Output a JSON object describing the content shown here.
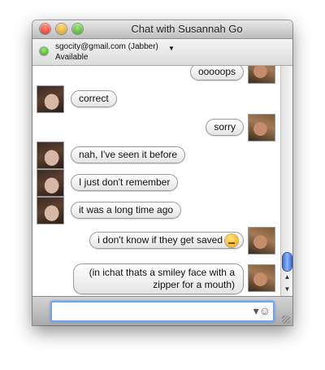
{
  "window": {
    "title": "Chat with Susannah Go"
  },
  "account": {
    "name": "sgocity@gmail.com (Jabber)",
    "presence": "Available"
  },
  "messages": [
    {
      "from": "him",
      "text": "ooooops"
    },
    {
      "from": "her",
      "text": "correct"
    },
    {
      "from": "him",
      "text": "sorry"
    },
    {
      "from": "her",
      "text": "nah, I've seen it before"
    },
    {
      "from": "her",
      "text": "I just don't remember"
    },
    {
      "from": "her",
      "text": "it was a long time ago"
    },
    {
      "from": "him",
      "text": "i don't know if they get saved"
    },
    {
      "from": "him",
      "text": "(in ichat thats a smiley face with a zipper for a mouth)"
    }
  ],
  "input": {
    "value": "",
    "placeholder": ""
  },
  "icons": {
    "close": "close-icon",
    "minimize": "minimize-icon",
    "zoom": "zoom-icon",
    "status": "status-available-icon",
    "account_menu": "chevron-down-icon",
    "zipper_smiley": "zipper-mouth-smiley-icon",
    "smiley_picker": "smiley-picker-icon",
    "resize": "resize-grip-icon"
  },
  "colors": {
    "available": "#2c9a10",
    "input_focus": "#6fa3ea",
    "scroll_thumb": "#3d6fd6"
  }
}
